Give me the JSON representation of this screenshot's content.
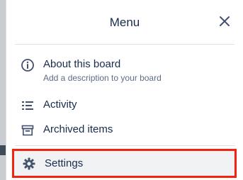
{
  "menu": {
    "title": "Menu",
    "items": [
      {
        "label": "About this board",
        "description": "Add a description to your board",
        "icon": "info-icon"
      },
      {
        "label": "Activity",
        "icon": "activity-icon"
      },
      {
        "label": "Archived items",
        "icon": "archive-icon"
      },
      {
        "label": "Settings",
        "icon": "gear-icon"
      }
    ]
  },
  "colors": {
    "highlight_border": "#f0240f",
    "text": "#172b4d",
    "subtext": "#5e6c84"
  }
}
